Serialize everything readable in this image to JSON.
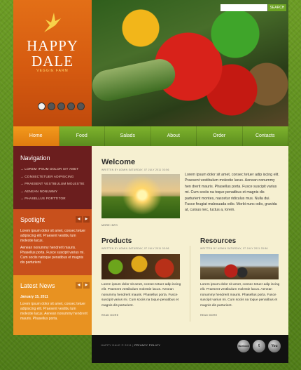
{
  "header": {
    "logo_title_line1": "HAPPY",
    "logo_title_line2": "DALE",
    "logo_sub": "VEGGIE FARM",
    "search_button": "SEARCH",
    "slider_dots": 5,
    "slider_active": 1
  },
  "nav": {
    "items": [
      "Home",
      "Food",
      "Salads",
      "About",
      "Order",
      "Contacts"
    ],
    "active": "Home"
  },
  "sidebar": {
    "navigation": {
      "title": "Navigation",
      "links": [
        "LOREM IPSUM DOLOR SIT AMET",
        "CONSECTETUER ADIPISCING",
        "PRAESENT VESTIBULUM MOLESTIE",
        "AENEAN NONUMMY",
        "PHASELLUS PORTTITOR"
      ]
    },
    "spotlight": {
      "title": "Spotlight",
      "text1": "Lorem ipsum dolor sit amet, consec tetuer adipiscing elit. Praesent vestibu lum molestie lacus.",
      "text2": "Aenean nonummy hendrerit mauris. Phasellus porta. Fusce suscipit varius mi. Cum sociis natoque penatibus et magnis dis parturient."
    },
    "news": {
      "title": "Latest News",
      "date": "January 15, 2011",
      "text": "Lorem ipsum dolor sit amet, consec tetuer adipiscing elit. Praesent vestibu lum molestie lacus. Aenean nonummy hendrerit mauris. Phasellus porta."
    }
  },
  "main": {
    "welcome": {
      "title": "Welcome",
      "meta": "WRITTEN BY ADMIN  SATURDAY, 07 JULY 2011 03:56",
      "text": "Lorem ipsum dolor sit amet, consec tetuer adip iscing elit. Praesent vestibulum molestie lacus. Aenean nonummy hen drerit mauris. Phasellus porta. Fusce suscipit varius mi. Cum sociis na toque penatibus et magnis dis parturient montes, nascetur ridiculus mus. Nulla dui. Fusce feugiat malesuada odio. Morbi nunc odio, gravida at, cursus nec, luctus a, lorem.",
      "more": "MORE INFO"
    },
    "products": {
      "title": "Products",
      "meta": "WRITTEN BY ADMIN  SATURDAY, 07 JULY 2011 03:56",
      "text": "Lorem ipsum dolor sit amet, consec tetuer adip iscing elit. Praesent vestibulum molestie lacus. Aenean nonummy hendrerit mauris. Phasellus porta. Fusce suscipit varius mi. Cum sociis na toque penatibus et magnis dis parturient.",
      "more": "READ MORE"
    },
    "resources": {
      "title": "Resources",
      "meta": "WRITTEN BY ADMIN  SATURDAY, 07 JULY 2011 03:56",
      "text": "Lorem ipsum dolor sit amet, consec tetuer adip iscing elit. Praesent vestibulum molestie lacus. Aenean nonummy hendrerit mauris. Phasellus porta. Fusce suscipit varius mi. Cum sociis na toque penatibus et magnis dis parturient.",
      "more": "READ MORE"
    }
  },
  "footer": {
    "copyright": "HAPPY DALE © 2011 |",
    "privacy": "PRIVACY POLICY",
    "social": [
      "facebook",
      "t",
      "You"
    ]
  },
  "colors": {
    "background_green": "#5c8a1f",
    "logo_orange": "#e36f17",
    "nav_green": "#6ea626",
    "nav_active_orange": "#f39a1c",
    "sidebar_maroon": "#6b1e1e",
    "sidebar_rust": "#c8501c",
    "sidebar_amber": "#e89221",
    "content_cream": "#f6f0d1",
    "footer_black": "#111111"
  }
}
